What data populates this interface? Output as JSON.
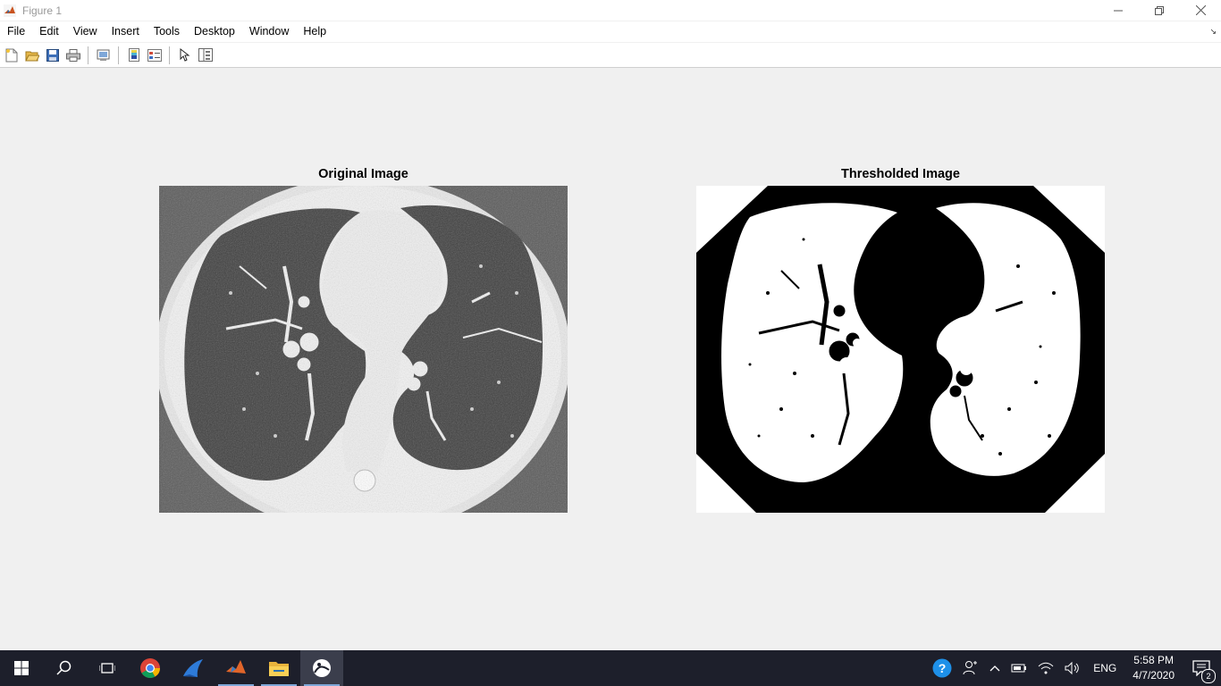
{
  "window": {
    "title": "Figure 1"
  },
  "menu": [
    "File",
    "Edit",
    "View",
    "Insert",
    "Tools",
    "Desktop",
    "Window",
    "Help"
  ],
  "toolbar": {
    "buttons": [
      "new-figure-icon",
      "open-file-icon",
      "save-icon",
      "print-icon",
      "link-plot-icon",
      "insert-colorbar-icon",
      "insert-legend-icon",
      "edit-plot-icon",
      "open-property-inspector-icon"
    ]
  },
  "figure": {
    "axes": [
      {
        "title": "Original Image",
        "kind": "grayscale-ct-scan"
      },
      {
        "title": "Thresholded Image",
        "kind": "binary-mask"
      }
    ]
  },
  "taskbar": {
    "apps": [
      "start-icon",
      "search-icon",
      "task-view-icon",
      "chrome-icon",
      "app-shark-icon",
      "matlab-icon",
      "file-explorer-icon",
      "figure-app-icon"
    ],
    "language": "ENG",
    "time": "5:58 PM",
    "date": "4/7/2020",
    "notification_count": "2"
  }
}
